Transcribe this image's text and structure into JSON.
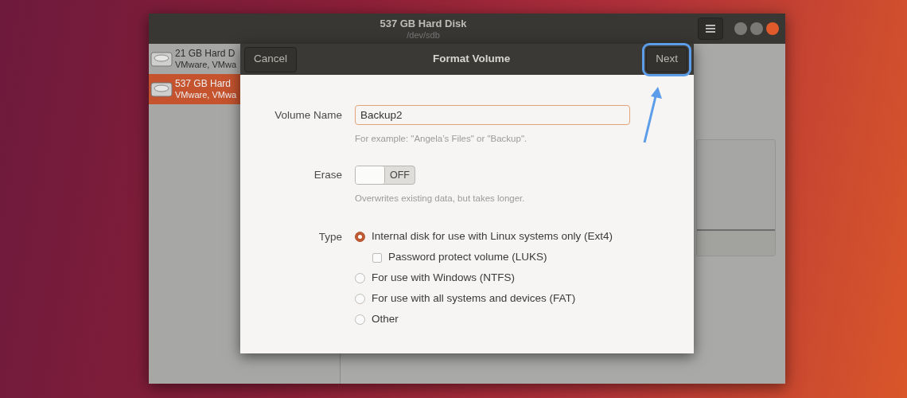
{
  "window": {
    "title": "537 GB Hard Disk",
    "subtitle": "/dev/sdb"
  },
  "sidebar": {
    "items": [
      {
        "title": "21 GB Hard D",
        "subtitle": "VMware, VMwa",
        "selected": false
      },
      {
        "title": "537 GB Hard",
        "subtitle": "VMware, VMwa",
        "selected": true
      }
    ]
  },
  "dialog": {
    "title": "Format Volume",
    "cancel": "Cancel",
    "next": "Next",
    "next_highlighted": true,
    "volume_name": {
      "label": "Volume Name",
      "value": "Backup2",
      "hint": "For example: \"Angela’s Files\" or \"Backup\"."
    },
    "erase": {
      "label": "Erase",
      "on": false,
      "state_text": "OFF",
      "hint": "Overwrites existing data, but takes longer."
    },
    "type": {
      "label": "Type",
      "options": [
        {
          "label": "Internal disk for use with Linux systems only (Ext4)",
          "selected": true,
          "children": [
            {
              "label": "Password protect volume (LUKS)",
              "checked": false
            }
          ]
        },
        {
          "label": "For use with Windows (NTFS)",
          "selected": false
        },
        {
          "label": "For use with all systems and devices (FAT)",
          "selected": false
        },
        {
          "label": "Other",
          "selected": false
        }
      ]
    }
  }
}
